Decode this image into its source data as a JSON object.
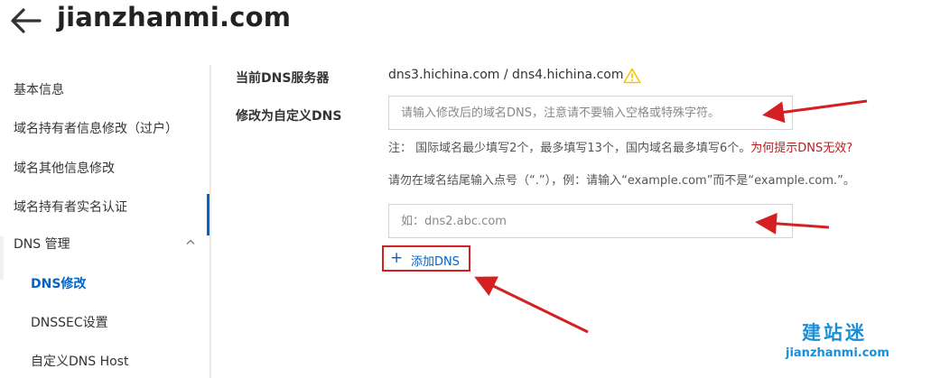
{
  "header": {
    "title": "jianzhanmi.com"
  },
  "sidebar": {
    "items": [
      "基本信息",
      "域名持有者信息修改（过户）",
      "域名其他信息修改",
      "域名持有者实名认证"
    ],
    "group": {
      "label": "DNS 管理",
      "expanded": true
    },
    "subitems": [
      "DNS修改",
      "DNSSEC设置",
      "自定义DNS Host"
    ],
    "active": "DNS修改"
  },
  "form": {
    "current_label": "当前DNS服务器",
    "current_value": "dns3.hichina.com / dns4.hichina.com",
    "custom_label": "修改为自定义DNS",
    "input1": {
      "placeholder": "请输入修改后的域名DNS，注意请不要输入空格或特殊字符。",
      "value": ""
    },
    "note1": "注：  国际域名最少填写2个，最多填写13个，国内域名最多填写6个。",
    "note1_link": "为何提示DNS无效?",
    "note2": "请勿在域名结尾输入点号（“.”），例：请输入“example.com”而不是“example.com.”。",
    "input2": {
      "placeholder": "如：dns2.abc.com",
      "value": ""
    },
    "add_dns_label": "添加DNS"
  },
  "watermark": {
    "cn": "建站迷",
    "en": "jianzhanmi.com"
  },
  "colors": {
    "link_blue": "#0064c8",
    "annotation_red": "#d42020",
    "warning_yellow": "#f5c400",
    "watermark_blue": "#1a8fd8"
  }
}
